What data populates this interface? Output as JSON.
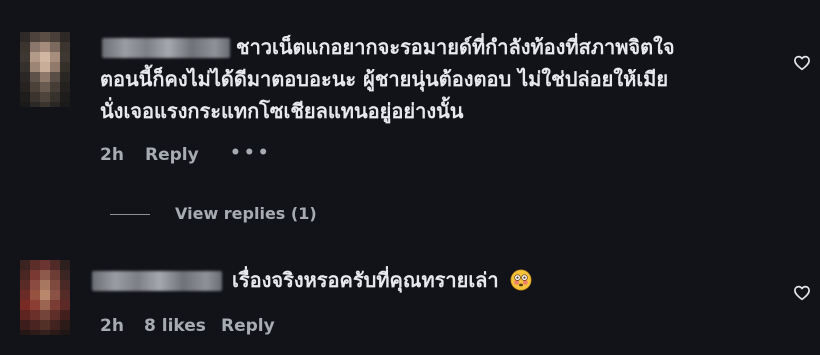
{
  "comments": [
    {
      "text_lines": [
        "ชาวเน็ตแกอยากจะรอมายด์ที่กำลังท้องที่สภาพจิตใจ",
        "ตอนนี้ก็คงไม่ได้ดีมาตอบอะนะ ผู้ชายนุ่นต้องตอบ ไม่ใช่ปล่อยให้เมีย",
        "นั่งเจอแรงกระแทกโซเชียลแทนอยู่อย่างนั้น"
      ],
      "time": "2h",
      "reply_label": "Reply",
      "more_label": "•••",
      "view_replies_label": "View replies (1)"
    },
    {
      "text": "เรื่องจริงหรอครับที่คุณทรายเล่า",
      "emoji": "flushed-face-icon",
      "time": "2h",
      "likes_label": "8 likes",
      "reply_label": "Reply"
    }
  ],
  "colors": {
    "background": "#111318",
    "text": "#e7e9ee",
    "secondary": "#a7abb2"
  }
}
